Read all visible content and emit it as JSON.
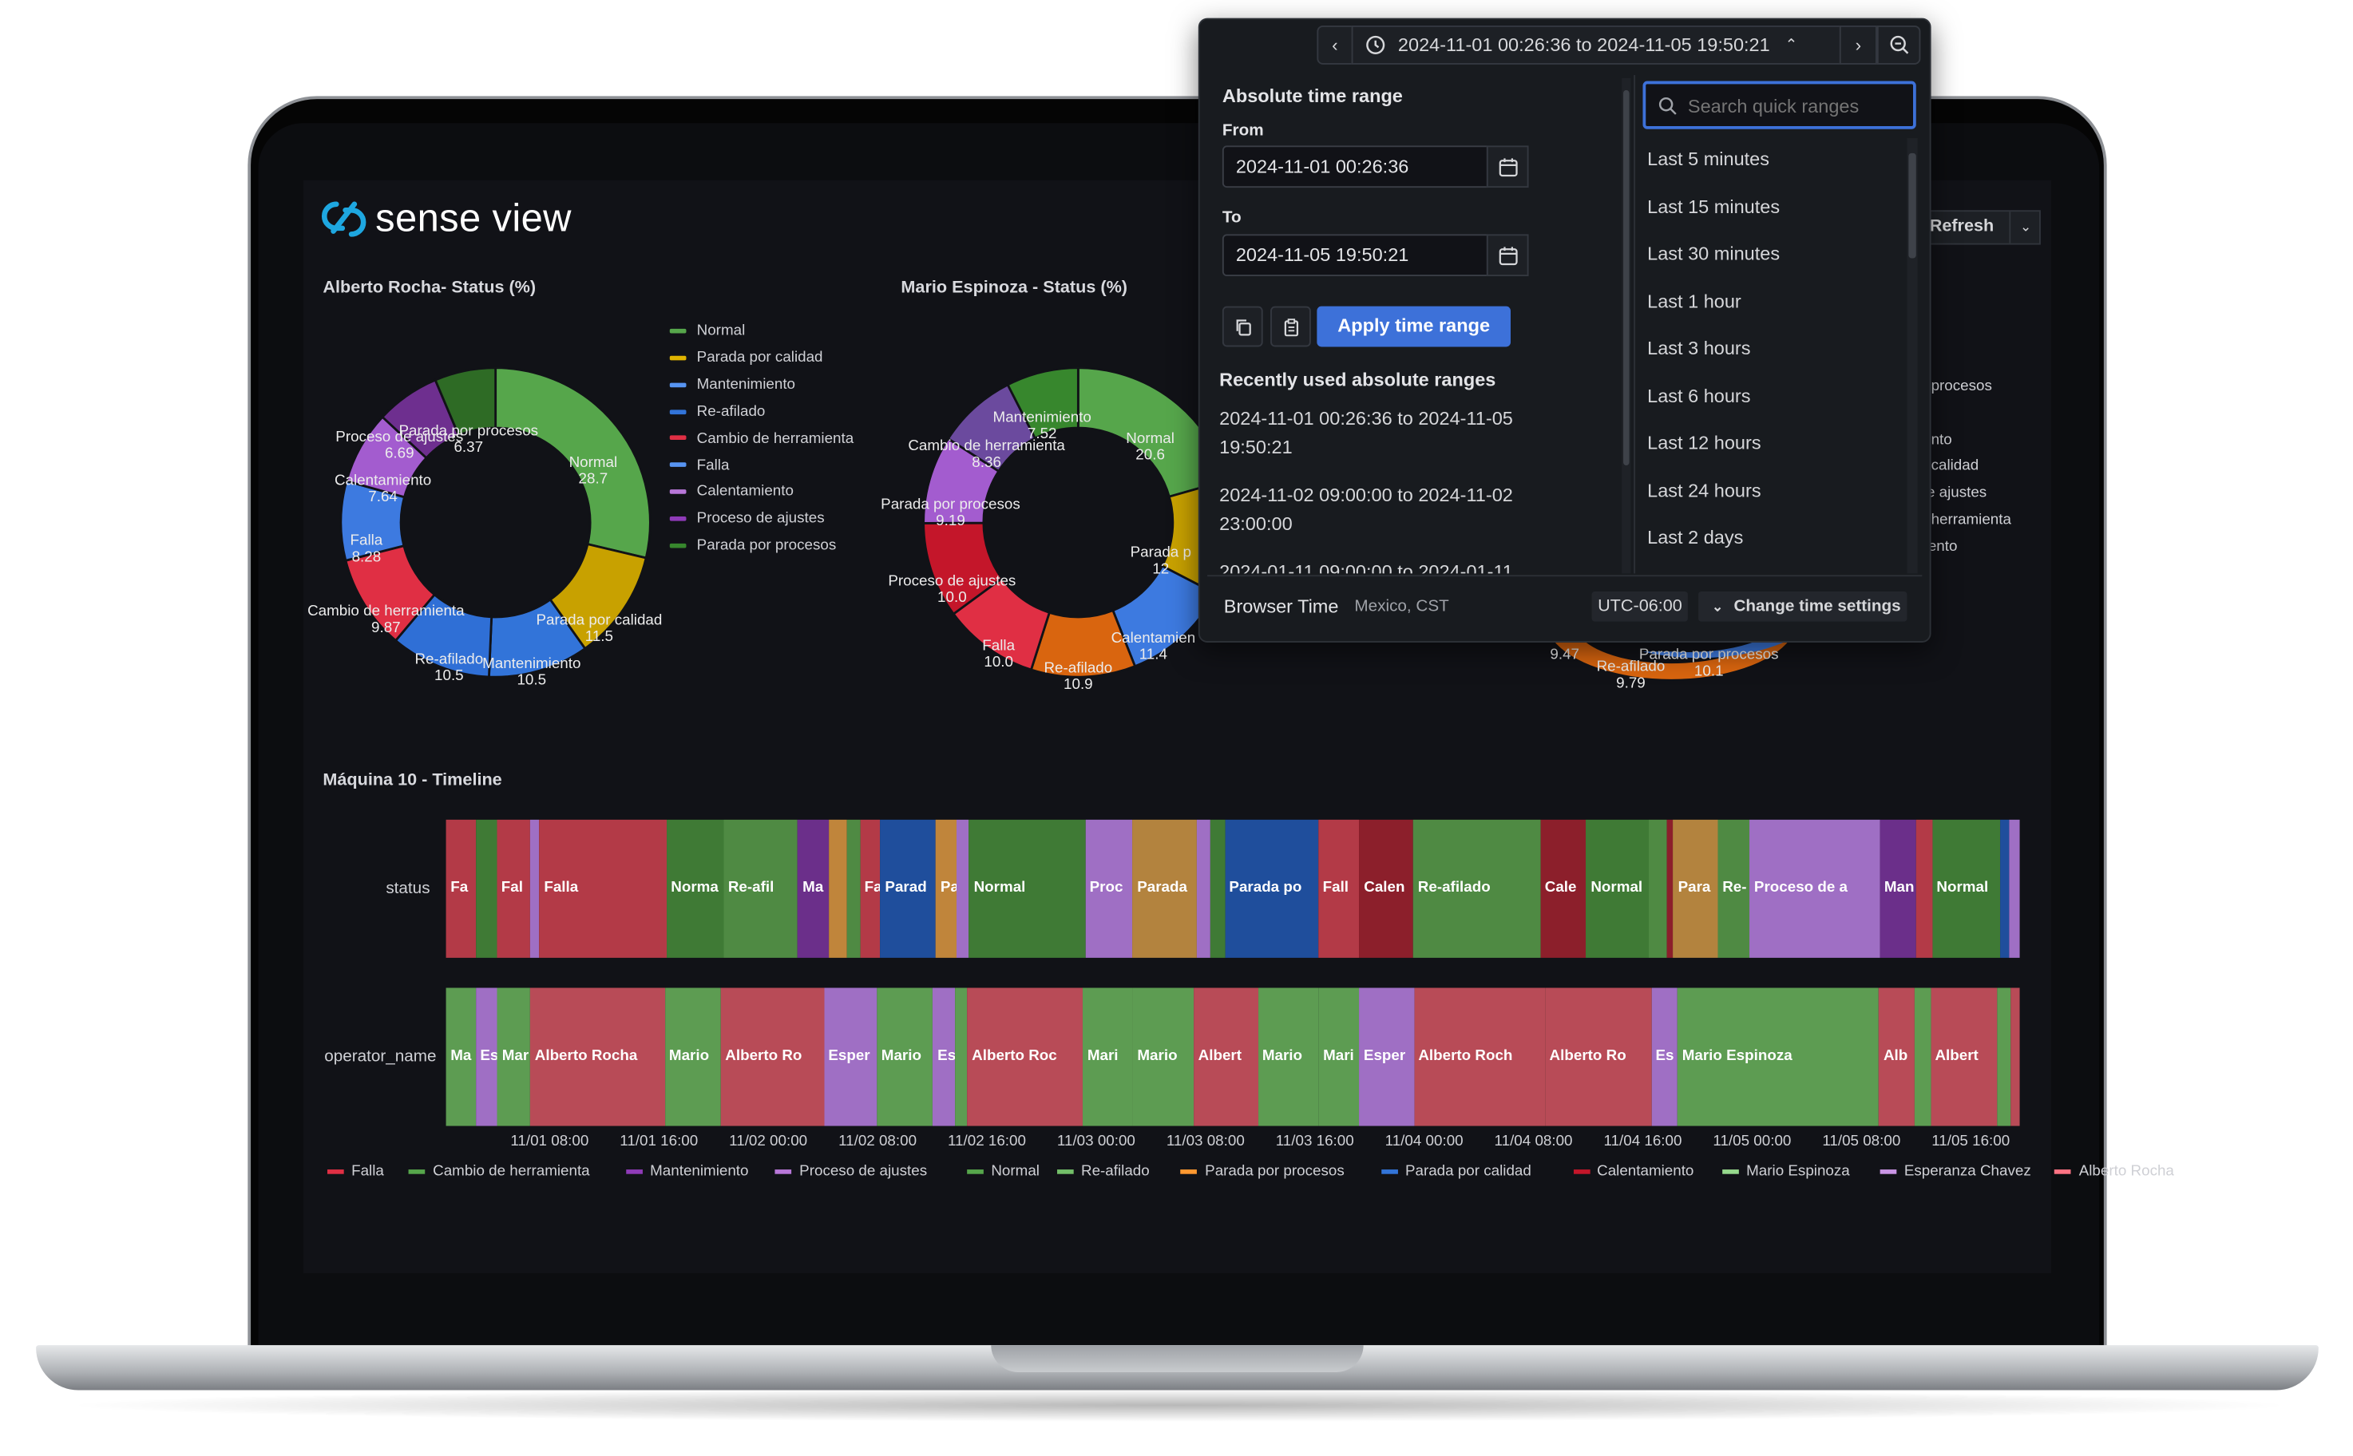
{
  "app": {
    "logo_text": "sense view",
    "refresh_label": "Refresh"
  },
  "panels": [
    {
      "title": "Alberto Rocha- Status (%)"
    },
    {
      "title": "Mario Espinoza - Status (%)"
    }
  ],
  "legend_left": [
    {
      "label": "Normal",
      "color": "#56a64b"
    },
    {
      "label": "Parada por calidad",
      "color": "#e0b400"
    },
    {
      "label": "Mantenimiento",
      "color": "#5794f2"
    },
    {
      "label": "Re-afilado",
      "color": "#3274d9"
    },
    {
      "label": "Cambio de herramienta",
      "color": "#e02f44"
    },
    {
      "label": "Falla",
      "color": "#5794f2"
    },
    {
      "label": "Calentamiento",
      "color": "#b877d9"
    },
    {
      "label": "Proceso de ajustes",
      "color": "#8f3bb8"
    },
    {
      "label": "Parada por procesos",
      "color": "#37872d"
    }
  ],
  "donut1_labels": [
    {
      "name": "Normal",
      "value": "28.7"
    },
    {
      "name": "Parada por calidad",
      "value": "11.5"
    },
    {
      "name": "Mantenimiento",
      "value": "10.5"
    },
    {
      "name": "Re-afilado",
      "value": "10.5"
    },
    {
      "name": "Cambio de herramienta",
      "value": "9.87"
    },
    {
      "name": "Falla",
      "value": "8.28"
    },
    {
      "name": "Calentamiento",
      "value": "7.64"
    },
    {
      "name": "Proceso de ajustes",
      "value": "6.69"
    },
    {
      "name": "Parada por procesos",
      "value": "6.37"
    }
  ],
  "donut2_labels": [
    {
      "name": "Normal",
      "value": "20.6"
    },
    {
      "name": "Parada p",
      "value": "12"
    },
    {
      "name": "Calentamien",
      "value": "11.4"
    },
    {
      "name": "Re-afilado",
      "value": "10.9"
    },
    {
      "name": "Falla",
      "value": "10.0"
    },
    {
      "name": "Proceso de ajustes",
      "value": "10.0"
    },
    {
      "name": "Parada por procesos",
      "value": "9.19"
    },
    {
      "name": "Cambio de herramienta",
      "value": "8.36"
    },
    {
      "name": "Mantenimiento",
      "value": "7.52"
    }
  ],
  "donut3_partial": {
    "legend": [
      "procesos",
      "nto",
      "calidad",
      "e ajustes",
      "herramienta",
      "ento"
    ],
    "labels": [
      {
        "name": "Re-afilado",
        "value": "9.79"
      },
      {
        "name": "Parada por procesos",
        "value": "10.1"
      },
      {
        "name": "",
        "value": "9.47"
      }
    ]
  },
  "chart_data": [
    {
      "type": "pie",
      "title": "Alberto Rocha- Status (%)",
      "categories": [
        "Normal",
        "Parada por calidad",
        "Mantenimiento",
        "Re-afilado",
        "Cambio de herramienta",
        "Falla",
        "Calentamiento",
        "Proceso de ajustes",
        "Parada por procesos"
      ],
      "values": [
        28.7,
        11.5,
        10.5,
        10.5,
        9.87,
        8.28,
        7.64,
        6.69,
        6.37
      ]
    },
    {
      "type": "pie",
      "title": "Mario Espinoza - Status (%)",
      "categories": [
        "Normal",
        "Parada por calidad",
        "Calentamiento",
        "Re-afilado",
        "Falla",
        "Proceso de ajustes",
        "Parada por procesos",
        "Cambio de herramienta",
        "Mantenimiento"
      ],
      "values": [
        20.6,
        12,
        11.4,
        10.9,
        10.0,
        10.0,
        9.19,
        8.36,
        7.52
      ]
    }
  ],
  "timeline": {
    "title": "Máquina 10 - Timeline",
    "row_labels": [
      "status",
      "operator_name"
    ],
    "status": [
      {
        "t": "Fa",
        "c": "#b33a47",
        "w": 1.9
      },
      {
        "t": "",
        "c": "#3f7a35",
        "w": 1.3
      },
      {
        "t": "Fal",
        "c": "#b33a47",
        "w": 2.1
      },
      {
        "t": "",
        "c": "#9f6fc4",
        "w": 0.6
      },
      {
        "t": "Falla",
        "c": "#b33a47",
        "w": 8.0
      },
      {
        "t": "Norma",
        "c": "#3f7a35",
        "w": 3.6
      },
      {
        "t": "Re-afil",
        "c": "#4f8a43",
        "w": 4.7
      },
      {
        "t": "Ma",
        "c": "#6b2f8a",
        "w": 1.9
      },
      {
        "t": "",
        "c": "#c0853b",
        "w": 1.2
      },
      {
        "t": "",
        "c": "#4f8a43",
        "w": 0.8
      },
      {
        "t": "Fa",
        "c": "#b33a47",
        "w": 1.3
      },
      {
        "t": "Parad",
        "c": "#1f4e9c",
        "w": 3.5
      },
      {
        "t": "Pa",
        "c": "#c0853b",
        "w": 1.3
      },
      {
        "t": "",
        "c": "#9f6fc4",
        "w": 0.8
      },
      {
        "t": "Normal",
        "c": "#3f7a35",
        "w": 7.3
      },
      {
        "t": "Proc",
        "c": "#9f6fc4",
        "w": 3.0
      },
      {
        "t": "Parada",
        "c": "#b3833e",
        "w": 4.0
      },
      {
        "t": "",
        "c": "#9f6fc4",
        "w": 0.9
      },
      {
        "t": "",
        "c": "#3f7a35",
        "w": 0.9
      },
      {
        "t": "Parada po",
        "c": "#1f4e9c",
        "w": 5.9
      },
      {
        "t": "Fall",
        "c": "#b33a47",
        "w": 2.6
      },
      {
        "t": "Calen",
        "c": "#8c1f2b",
        "w": 3.4
      },
      {
        "t": "Re-afilado",
        "c": "#4f8a43",
        "w": 8.0
      },
      {
        "t": "Cale",
        "c": "#8c1f2b",
        "w": 2.9
      },
      {
        "t": "Normal",
        "c": "#3f7a35",
        "w": 3.9
      },
      {
        "t": "",
        "c": "#4f8a43",
        "w": 1.2
      },
      {
        "t": "",
        "c": "#8c1f2b",
        "w": 0.4
      },
      {
        "t": "Para",
        "c": "#b3833e",
        "w": 2.8
      },
      {
        "t": "Re-",
        "c": "#4f8a43",
        "w": 2.0
      },
      {
        "t": "Proceso de a",
        "c": "#9f6fc4",
        "w": 8.2
      },
      {
        "t": "Man",
        "c": "#6b2f8a",
        "w": 2.3
      },
      {
        "t": "",
        "c": "#b33a47",
        "w": 1.0
      },
      {
        "t": "Normal",
        "c": "#3f7a35",
        "w": 4.3
      },
      {
        "t": "",
        "c": "#1f4e9c",
        "w": 0.6
      },
      {
        "t": "",
        "c": "#9f6fc4",
        "w": 0.6
      }
    ],
    "operator": [
      {
        "t": "Ma",
        "c": "#5d9c52",
        "w": 1.9
      },
      {
        "t": "Es",
        "c": "#9f6fc4",
        "w": 1.4
      },
      {
        "t": "Mar",
        "c": "#5d9c52",
        "w": 2.1
      },
      {
        "t": "Alberto Rocha",
        "c": "#b84b57",
        "w": 8.6
      },
      {
        "t": "Mario",
        "c": "#5d9c52",
        "w": 3.6
      },
      {
        "t": "Alberto Ro",
        "c": "#b84b57",
        "w": 6.6
      },
      {
        "t": "Esper",
        "c": "#9f6fc4",
        "w": 3.4
      },
      {
        "t": "Mario",
        "c": "#5d9c52",
        "w": 3.6
      },
      {
        "t": "Es",
        "c": "#9f6fc4",
        "w": 1.4
      },
      {
        "t": "",
        "c": "#5d9c52",
        "w": 0.8
      },
      {
        "t": "Alberto Roc",
        "c": "#b84b57",
        "w": 7.4
      },
      {
        "t": "Mari",
        "c": "#5d9c52",
        "w": 3.2
      },
      {
        "t": "Mario",
        "c": "#5d9c52",
        "w": 3.9
      },
      {
        "t": "Albert",
        "c": "#b84b57",
        "w": 4.1
      },
      {
        "t": "Mario",
        "c": "#5d9c52",
        "w": 3.9
      },
      {
        "t": "Mari",
        "c": "#5d9c52",
        "w": 2.6
      },
      {
        "t": "Esper",
        "c": "#9f6fc4",
        "w": 3.5
      },
      {
        "t": "Alberto Roch",
        "c": "#b84b57",
        "w": 8.4
      },
      {
        "t": "Alberto Ro",
        "c": "#b84b57",
        "w": 6.8
      },
      {
        "t": "Es",
        "c": "#9f6fc4",
        "w": 1.7
      },
      {
        "t": "Mario Espinoza",
        "c": "#5d9c52",
        "w": 12.9
      },
      {
        "t": "Alb",
        "c": "#b84b57",
        "w": 2.3
      },
      {
        "t": "",
        "c": "#5d9c52",
        "w": 1.0
      },
      {
        "t": "Albert",
        "c": "#b84b57",
        "w": 4.3
      },
      {
        "t": "",
        "c": "#5d9c52",
        "w": 0.8
      },
      {
        "t": "",
        "c": "#b84b57",
        "w": 0.6
      }
    ],
    "ticks": [
      "11/01 08:00",
      "11/01 16:00",
      "11/02 00:00",
      "11/02 08:00",
      "11/02 16:00",
      "11/03 00:00",
      "11/03 08:00",
      "11/03 16:00",
      "11/04 00:00",
      "11/04 08:00",
      "11/04 16:00",
      "11/05 00:00",
      "11/05 08:00",
      "11/05 16:00"
    ],
    "legend": [
      {
        "label": "Falla",
        "color": "#e02f44"
      },
      {
        "label": "Cambio de herramienta",
        "color": "#56a64b"
      },
      {
        "label": "Mantenimiento",
        "color": "#8f3bb8"
      },
      {
        "label": "Proceso de ajustes",
        "color": "#b877d9"
      },
      {
        "label": "Normal",
        "color": "#56a64b"
      },
      {
        "label": "Re-afilado",
        "color": "#73bf69"
      },
      {
        "label": "Parada por procesos",
        "color": "#ff9830"
      },
      {
        "label": "Parada por calidad",
        "color": "#3274d9"
      },
      {
        "label": "Calentamiento",
        "color": "#c4162a"
      },
      {
        "label": "Mario Espinoza",
        "color": "#96d98d"
      },
      {
        "label": "Esperanza Chavez",
        "color": "#ca95e5"
      },
      {
        "label": "Alberto Rocha",
        "color": "#ff7383"
      }
    ]
  },
  "time_picker": {
    "range_display": "2024-11-01 00:26:36 to 2024-11-05 19:50:21",
    "absolute_title": "Absolute time range",
    "from_label": "From",
    "from_value": "2024-11-01 00:26:36",
    "to_label": "To",
    "to_value": "2024-11-05 19:50:21",
    "apply_label": "Apply time range",
    "recent_title": "Recently used absolute ranges",
    "recent": [
      "2024-11-01 00:26:36 to 2024-11-05 19:50:21",
      "2024-11-02 09:00:00 to 2024-11-02 23:00:00",
      "2024-01-11 09:00:00 to 2024-01-11"
    ],
    "search_placeholder": "Search quick ranges",
    "quick_ranges": [
      "Last 5 minutes",
      "Last 15 minutes",
      "Last 30 minutes",
      "Last 1 hour",
      "Last 3 hours",
      "Last 6 hours",
      "Last 12 hours",
      "Last 24 hours",
      "Last 2 days"
    ],
    "browser_time_label": "Browser Time",
    "timezone": "Mexico, CST",
    "utc_offset": "UTC-06:00",
    "change_settings_label": "Change time settings",
    "accent": "#3d71d9"
  }
}
